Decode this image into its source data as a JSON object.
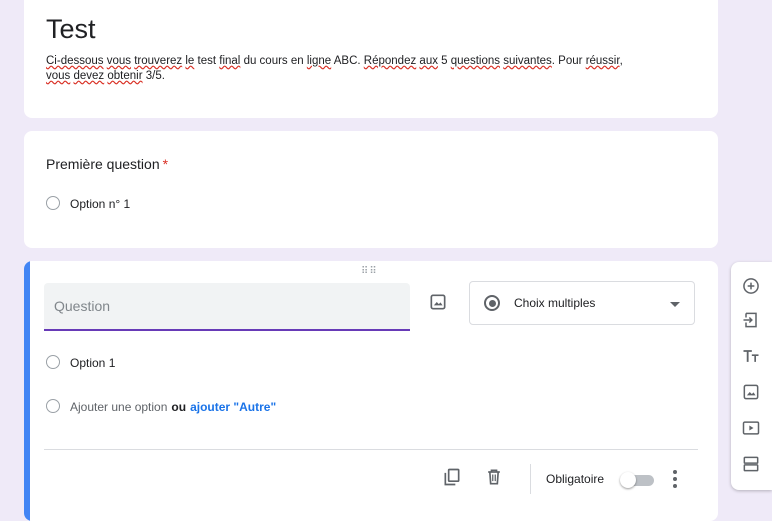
{
  "form": {
    "title": "Test",
    "description_parts": [
      {
        "text": "Ci-dessous",
        "sp": true
      },
      {
        "text": " ",
        "sp": false
      },
      {
        "text": "vous",
        "sp": true
      },
      {
        "text": " ",
        "sp": false
      },
      {
        "text": "trouverez",
        "sp": true
      },
      {
        "text": " ",
        "sp": false
      },
      {
        "text": "le",
        "sp": true
      },
      {
        "text": " test ",
        "sp": false
      },
      {
        "text": "final",
        "sp": true
      },
      {
        "text": " du cours en ",
        "sp": false
      },
      {
        "text": "ligne",
        "sp": true
      },
      {
        "text": " ABC. ",
        "sp": false
      },
      {
        "text": "Répondez",
        "sp": true
      },
      {
        "text": " ",
        "sp": false
      },
      {
        "text": "aux",
        "sp": true
      },
      {
        "text": " 5 ",
        "sp": false
      },
      {
        "text": "questions",
        "sp": true
      },
      {
        "text": " ",
        "sp": false
      },
      {
        "text": "suivantes",
        "sp": true
      },
      {
        "text": ". Pour ",
        "sp": false
      },
      {
        "text": "réussir",
        "sp": true
      },
      {
        "text": ",",
        "sp": false
      },
      {
        "text": "\n",
        "sp": false
      },
      {
        "text": "vous",
        "sp": true
      },
      {
        "text": " ",
        "sp": false
      },
      {
        "text": "devez",
        "sp": true
      },
      {
        "text": " ",
        "sp": false
      },
      {
        "text": "obtenir",
        "sp": true
      },
      {
        "text": " 3/5.",
        "sp": false
      }
    ]
  },
  "question1": {
    "title": "Première question",
    "required_mark": "*",
    "option": "Option n° 1"
  },
  "question2": {
    "placeholder": "Question",
    "type_label": "Choix multiples",
    "option": "Option 1",
    "add_option": "Ajouter une option",
    "or_text": "ou",
    "add_other": "ajouter \"Autre\"",
    "required_label": "Obligatoire",
    "required_on": false,
    "drag_handle": "⠿⠿"
  },
  "icons": {
    "image": "image-icon",
    "duplicate": "copy-icon",
    "delete": "trash-icon",
    "more": "more-vert-icon",
    "toolbar": [
      "add-circle-icon",
      "import-icon",
      "title-icon",
      "image-icon",
      "video-icon",
      "section-icon"
    ]
  },
  "colors": {
    "accent": "#4285f4",
    "focus": "#673ab7",
    "link": "#1a73e8",
    "required": "#d93025"
  }
}
